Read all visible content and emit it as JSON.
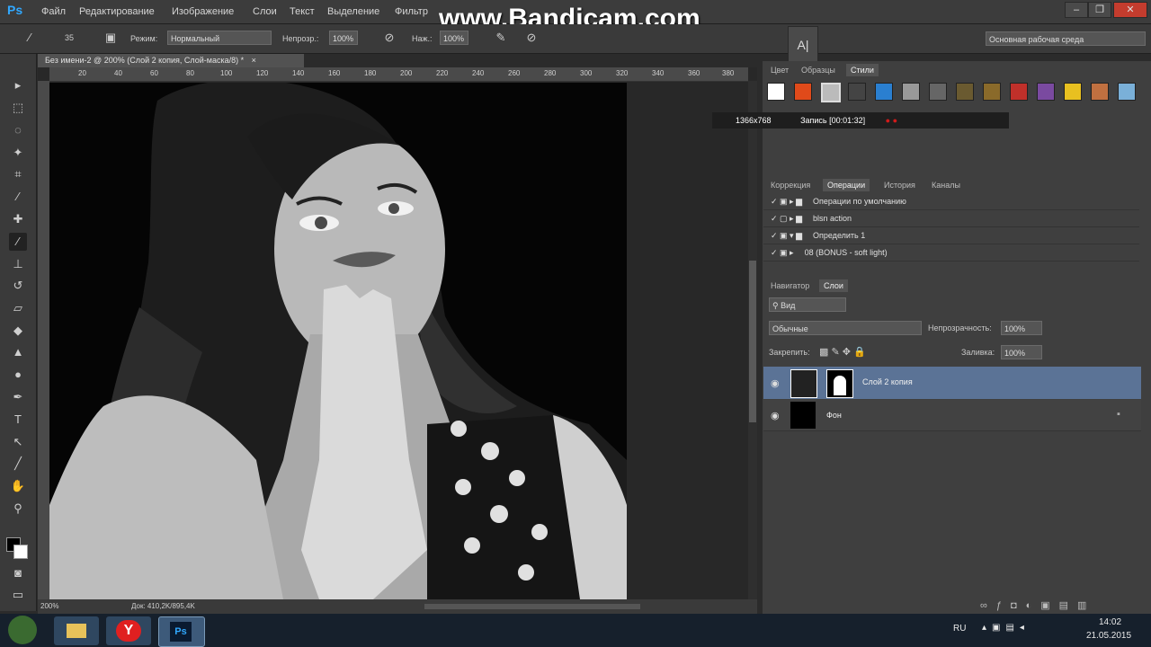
{
  "app": {
    "logo": "Ps",
    "watermark": "www.Bandicam.com"
  },
  "menu": [
    "Файл",
    "Редактирование",
    "Изображение",
    "Слои",
    "Текст",
    "Выделение",
    "Фильтр"
  ],
  "options": {
    "brush_size": "35",
    "mode_label": "Режим:",
    "mode_value": "Нормальный",
    "opacity_label": "Непрозр.:",
    "opacity_value": "100%",
    "flow_label": "Наж.:",
    "flow_value": "100%",
    "workspace": "Основная рабочая среда"
  },
  "document": {
    "tab_title": "Без имени-2 @ 200% (Слой 2 копия, Слой-маска/8) *",
    "ruler_ticks": [
      "20",
      "40",
      "60",
      "80",
      "100",
      "120",
      "140",
      "160",
      "180",
      "200",
      "220",
      "240",
      "260",
      "280",
      "300",
      "320",
      "340",
      "360",
      "380"
    ],
    "zoom": "200%",
    "doc_size": "Док: 410,2K/895,4K"
  },
  "styles_panel": {
    "tabs": [
      "Цвет",
      "Образцы",
      "Стили"
    ],
    "active_tab": "Стили"
  },
  "recorder": {
    "resolution": "1366x768",
    "record": "Запись [00:01:32]"
  },
  "actions_panel": {
    "tabs": [
      "Коррекция",
      "Операции",
      "История",
      "Каналы"
    ],
    "active_tab": "Операции",
    "rows": [
      {
        "label": "Операции по умолчанию"
      },
      {
        "label": "blsn action"
      },
      {
        "label": "Определить 1"
      },
      {
        "label": "08 (BONUS - soft light)"
      }
    ]
  },
  "layers_panel": {
    "tabs": [
      "Навигатор",
      "Слои"
    ],
    "active_tab": "Слои",
    "filter": "Вид",
    "blend_mode": "Обычные",
    "opacity_label": "Непрозрачность:",
    "opacity_value": "100%",
    "lock_label": "Закрепить:",
    "fill_label": "Заливка:",
    "fill_value": "100%",
    "layers": [
      {
        "name": "Слой 2 копия"
      },
      {
        "name": "Фон"
      }
    ]
  },
  "taskbar": {
    "lang": "RU",
    "time": "14:02",
    "date": "21.05.2015"
  },
  "colors": {
    "accent": "#31a8ff",
    "selected_layer": "#5b7396",
    "record_red": "#d11a1a"
  }
}
